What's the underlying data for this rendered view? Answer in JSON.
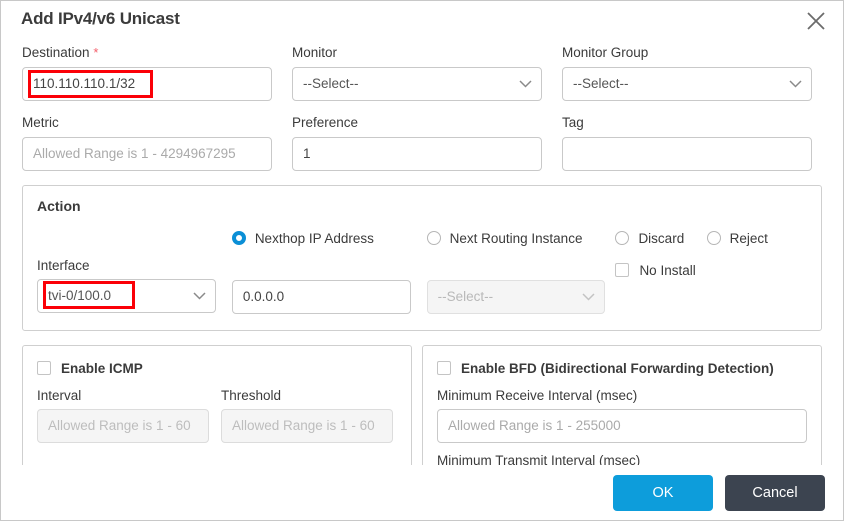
{
  "dialog": {
    "title": "Add IPv4/v6 Unicast",
    "close_icon": "close-icon"
  },
  "fields": {
    "destination": {
      "label": "Destination",
      "required_marker": "*",
      "value": "110.110.110.1/32"
    },
    "monitor": {
      "label": "Monitor",
      "value": "--Select--"
    },
    "monitor_group": {
      "label": "Monitor Group",
      "value": "--Select--"
    },
    "metric": {
      "label": "Metric",
      "placeholder": "Allowed Range is 1 - 4294967295",
      "value": ""
    },
    "preference": {
      "label": "Preference",
      "value": "1"
    },
    "tag": {
      "label": "Tag",
      "value": ""
    }
  },
  "action": {
    "title": "Action",
    "interface": {
      "label": "Interface",
      "value": "tvi-0/100.0"
    },
    "nexthop": {
      "radio_label": "Nexthop IP Address",
      "selected": true,
      "value": "0.0.0.0"
    },
    "next_routing_instance": {
      "radio_label": "Next Routing Instance",
      "selected": false,
      "value": "--Select--"
    },
    "discard": {
      "radio_label": "Discard",
      "selected": false
    },
    "reject": {
      "radio_label": "Reject",
      "selected": false
    },
    "no_install": {
      "label": "No Install",
      "checked": false
    }
  },
  "icmp": {
    "enable_label": "Enable ICMP",
    "checked": false,
    "interval": {
      "label": "Interval",
      "placeholder": "Allowed Range is 1 - 60"
    },
    "threshold": {
      "label": "Threshold",
      "placeholder": "Allowed Range is 1 - 60"
    }
  },
  "bfd": {
    "enable_label": "Enable BFD (Bidirectional Forwarding Detection)",
    "checked": false,
    "min_receive": {
      "label": "Minimum Receive Interval (msec)",
      "placeholder": "Allowed Range is 1 - 255000"
    },
    "min_transmit": {
      "label": "Minimum Transmit Interval (msec)"
    }
  },
  "footer": {
    "ok_label": "OK",
    "cancel_label": "Cancel"
  },
  "colors": {
    "accent": "#0d9ddb",
    "radio_selected": "#0b8fd6",
    "cancel_bg": "#3c4450",
    "annotation": "#fb0007",
    "required": "#f4606c"
  }
}
